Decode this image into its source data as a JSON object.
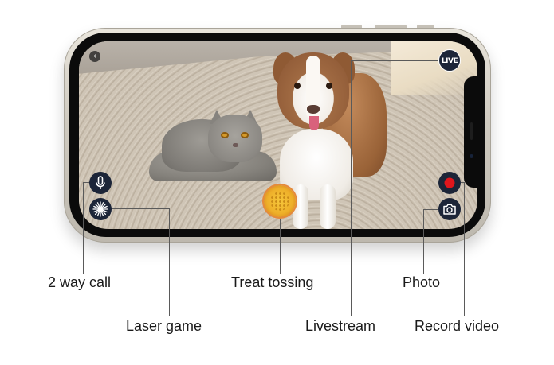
{
  "screen": {
    "live_badge": "LIVE",
    "back_glyph": "‹",
    "controls": [
      {
        "id": "mic",
        "icon": "microphone-icon"
      },
      {
        "id": "laser",
        "icon": "laser-burst-icon"
      },
      {
        "id": "treat",
        "icon": "treat-toss-icon"
      },
      {
        "id": "record",
        "icon": "record-dot-icon"
      },
      {
        "id": "photo",
        "icon": "camera-icon"
      }
    ],
    "colors": {
      "button_bg": "#1c2538",
      "record_red": "#e0161c",
      "treat_gold": "#f6c63b"
    }
  },
  "callouts": {
    "two_way_call": "2 way call",
    "laser_game": "Laser game",
    "treat_tossing": "Treat tossing",
    "livestream": "Livestream",
    "photo": "Photo",
    "record_video": "Record video"
  }
}
